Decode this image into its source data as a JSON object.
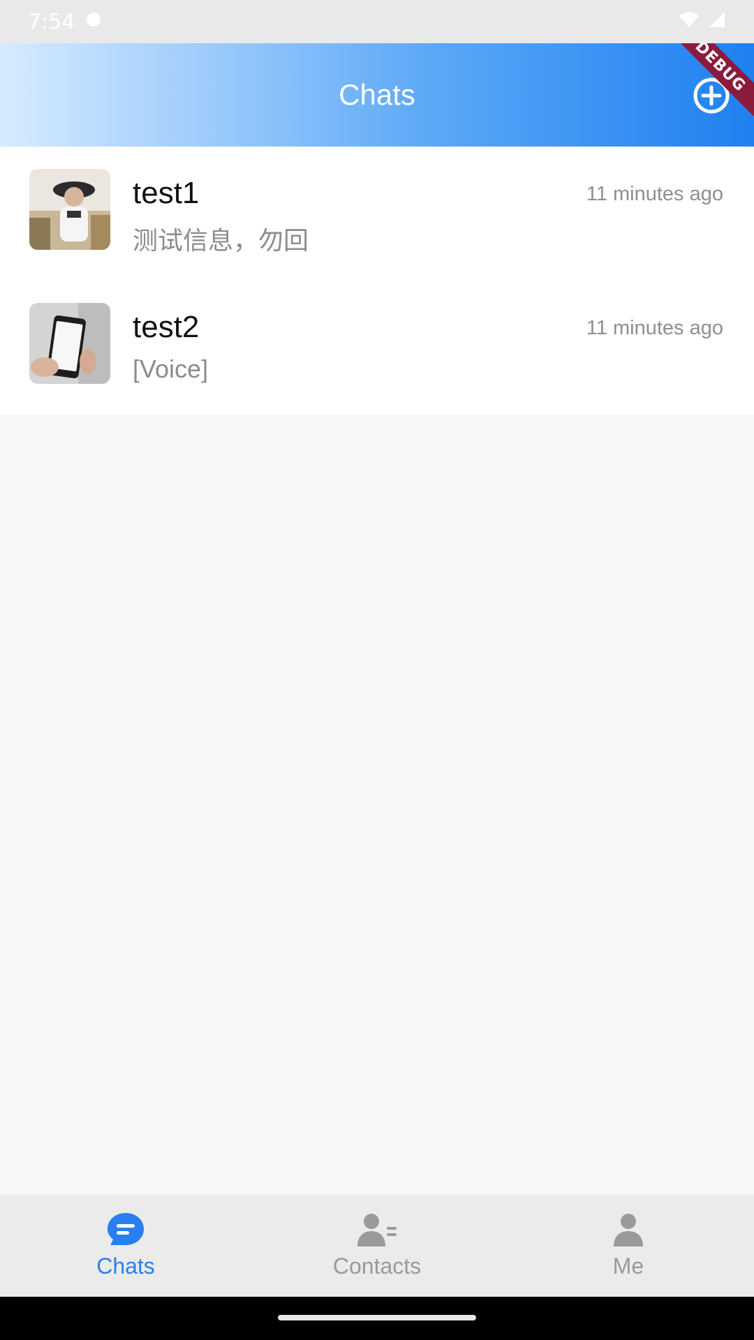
{
  "status_bar": {
    "time": "7:54"
  },
  "app_bar": {
    "title": "Chats",
    "debug_banner": "DEBUG",
    "gradient_start": "#d7ebff",
    "gradient_end": "#1f80f0"
  },
  "chats": [
    {
      "name": "test1",
      "time": "11 minutes ago",
      "preview": "测试信息，勿回",
      "avatar_icon": "woman-in-hat-photo-icon"
    },
    {
      "name": "test2",
      "time": "11 minutes ago",
      "preview": "[Voice]",
      "avatar_icon": "phone-in-hand-photo-icon"
    }
  ],
  "bottom_nav": {
    "items": [
      {
        "label": "Chats",
        "icon": "chat-bubble-icon",
        "active": true
      },
      {
        "label": "Contacts",
        "icon": "contacts-icon",
        "active": false
      },
      {
        "label": "Me",
        "icon": "person-icon",
        "active": false
      }
    ],
    "active_color": "#2a7ff0",
    "inactive_color": "#9a9a9a"
  }
}
